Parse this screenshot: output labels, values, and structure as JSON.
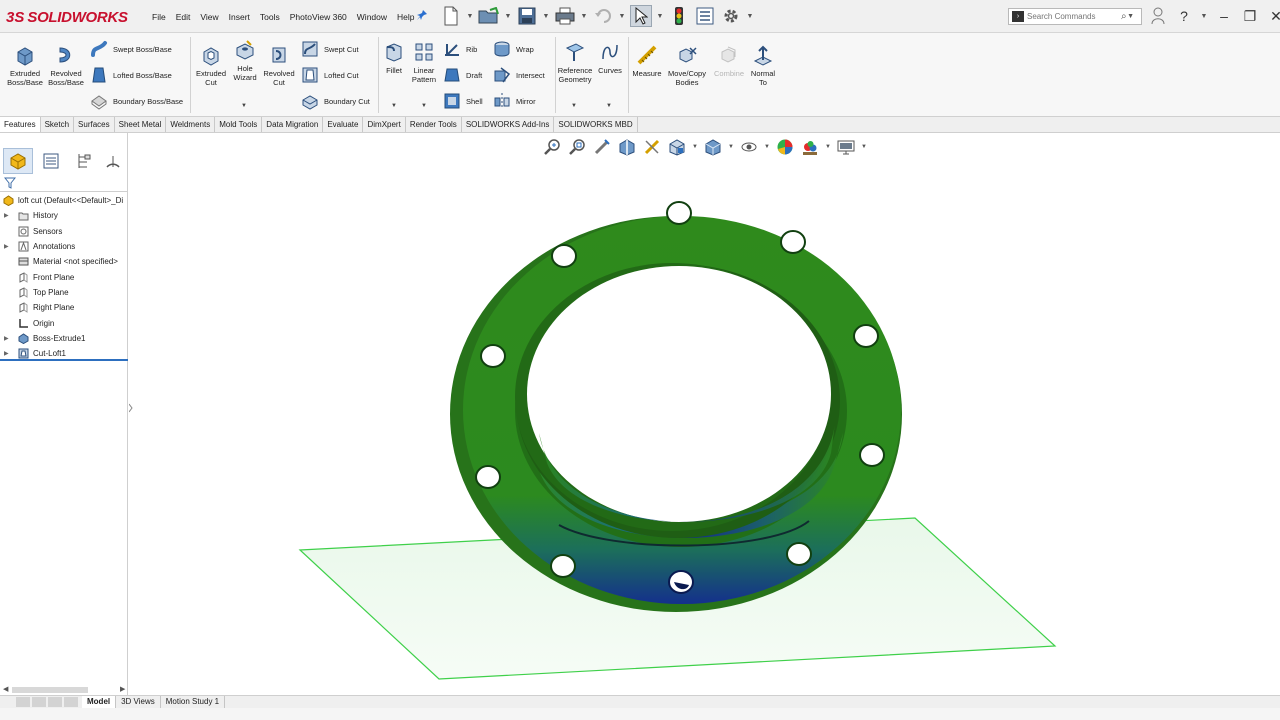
{
  "app": {
    "logo_ds": "3S",
    "logo_text": "SOLIDWORKS"
  },
  "menu": [
    "File",
    "Edit",
    "View",
    "Insert",
    "Tools",
    "PhotoView 360",
    "Window",
    "Help"
  ],
  "search": {
    "placeholder": "Search Commands"
  },
  "ribbon": {
    "extruded_boss": "Extruded Boss/Base",
    "revolved_boss": "Revolved Boss/Base",
    "swept_boss": "Swept Boss/Base",
    "lofted_boss": "Lofted Boss/Base",
    "boundary_boss": "Boundary Boss/Base",
    "extruded_cut": "Extruded Cut",
    "hole_wizard": "Hole Wizard",
    "revolved_cut": "Revolved Cut",
    "swept_cut": "Swept Cut",
    "lofted_cut": "Lofted Cut",
    "boundary_cut": "Boundary Cut",
    "fillet": "Fillet",
    "linear_pattern": "Linear Pattern",
    "rib": "Rib",
    "draft": "Draft",
    "shell": "Shell",
    "wrap": "Wrap",
    "intersect": "Intersect",
    "mirror": "Mirror",
    "reference_geometry": "Reference Geometry",
    "curves": "Curves",
    "measure": "Measure",
    "move_copy": "Move/Copy Bodies",
    "combine": "Combine",
    "normal_to": "Normal To"
  },
  "tabs": [
    "Features",
    "Sketch",
    "Surfaces",
    "Sheet Metal",
    "Weldments",
    "Mold Tools",
    "Data Migration",
    "Evaluate",
    "DimXpert",
    "Render Tools",
    "SOLIDWORKS Add-Ins",
    "SOLIDWORKS MBD"
  ],
  "active_tab": "Features",
  "tree": {
    "root": "loft cut  (Default<<Default>_Di",
    "items": [
      "History",
      "Sensors",
      "Annotations",
      "Material <not specified>",
      "Front Plane",
      "Top Plane",
      "Right Plane",
      "Origin",
      "Boss-Extrude1",
      "Cut-Loft1"
    ]
  },
  "bottom_tabs": [
    "Model",
    "3D Views",
    "Motion Study 1"
  ],
  "active_bottom_tab": "Model",
  "colors": {
    "part_green": "#2e8b1e",
    "part_blue": "#1a3f9a",
    "plane_green": "#3fd04a",
    "logo_red": "#c8102e"
  }
}
